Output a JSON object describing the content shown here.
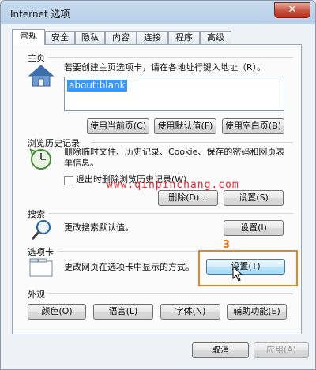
{
  "window": {
    "title": "Internet 选项",
    "close_label": "✕"
  },
  "tabs": [
    "常规",
    "安全",
    "隐私",
    "内容",
    "连接",
    "程序",
    "高级"
  ],
  "homepage": {
    "section_title": "主页",
    "description": "若要创建主页选项卡，请在各地址行键入地址（R）。",
    "address_value": "about:blank",
    "buttons": {
      "use_current": "使用当前页(C)",
      "use_default": "使用默认值(F)",
      "use_blank": "使用空白页(B)"
    }
  },
  "history": {
    "section_title": "浏览历史记录",
    "description": "删除临时文件、历史记录、Cookie、保存的密码和网页表单信息。",
    "checkbox_label": "退出时删除浏览历史记录(W)",
    "buttons": {
      "delete": "删除(D)...",
      "settings": "设置(S)"
    }
  },
  "search": {
    "section_title": "搜索",
    "description": "更改搜索默认值。",
    "buttons": {
      "settings": "设置(I)"
    }
  },
  "tabs_section": {
    "section_title": "选项卡",
    "description": "更改网页在选项卡中显示的方式。",
    "buttons": {
      "settings": "设置(T)"
    }
  },
  "appearance": {
    "section_title": "外观",
    "buttons": {
      "colors": "颜色(O)",
      "languages": "语言(L)",
      "fonts": "字体(N)",
      "accessibility": "辅助功能(E)"
    }
  },
  "footer": {
    "cancel": "取消",
    "apply": "应用(A)"
  },
  "annotation": {
    "step": "3"
  },
  "watermark": "www.qinpinchang.com",
  "colors": {
    "callout": "#d98a2c",
    "watermark": "#e8262e"
  }
}
